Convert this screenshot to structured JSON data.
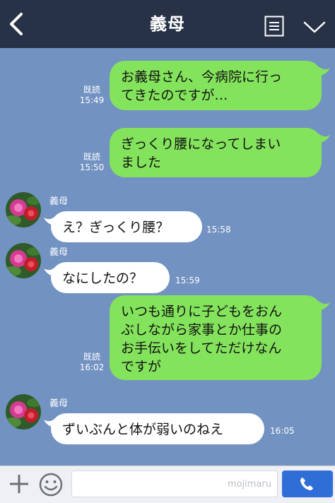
{
  "header": {
    "title": "義母"
  },
  "messages": [
    {
      "type": "sent",
      "lines": [
        "お義母さん、今病院に行っ",
        "てきたのですが…"
      ],
      "read": "既読",
      "time": "15:49"
    },
    {
      "type": "sent",
      "lines": [
        "ぎっくり腰になってしまい",
        "ました"
      ],
      "read": "既読",
      "time": "15:50"
    },
    {
      "type": "recv",
      "sender": "義母",
      "text": "え？ぎっくり腰？",
      "time": "15:58"
    },
    {
      "type": "recv",
      "sender": "義母",
      "text": "なにしたの？",
      "time": "15:59"
    },
    {
      "type": "sent",
      "lines": [
        "いつも通りに子どもをおん",
        "ぶしながら家事とか仕事の",
        "お手伝いをしてただけなん",
        "ですが"
      ],
      "read": "既読",
      "time": "16:02"
    },
    {
      "type": "recv",
      "sender": "義母",
      "text": "ずいぶんと体が弱いのねえ",
      "time": "16:05"
    }
  ],
  "footer": {
    "watermark": "mojimaru"
  },
  "icons": [
    "back-arrow-icon",
    "menu-icon",
    "chevron-down-icon",
    "plus-icon",
    "smiley-icon",
    "phone-icon"
  ],
  "colors": {
    "header": "#273246",
    "background": "#7292c2",
    "sent_bubble": "#84e35c",
    "received_bubble": "#ffffff",
    "call_button": "#2f6ed6"
  }
}
